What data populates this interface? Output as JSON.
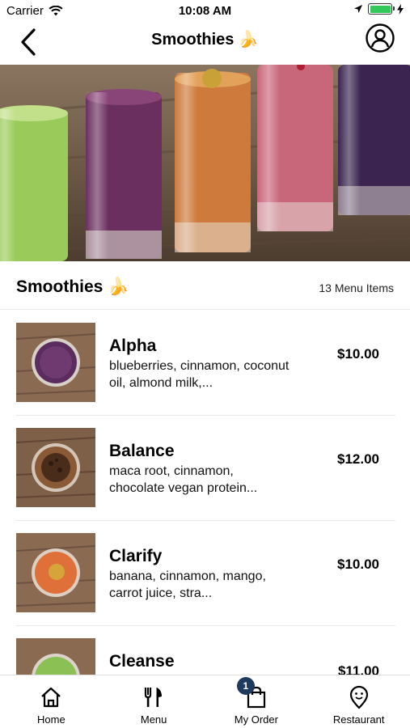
{
  "status_bar": {
    "carrier": "Carrier",
    "time": "10:08 AM",
    "battery_color": "#34c759"
  },
  "nav": {
    "title": "Smoothies 🍌",
    "back_icon": "chevron-left-icon",
    "profile_icon": "user-circle-icon"
  },
  "section": {
    "title": "Smoothies 🍌",
    "count": "13 Menu Items"
  },
  "menu_items": [
    {
      "name": "Alpha",
      "desc": " blueberries, cinnamon, coconut oil, almond milk,...",
      "price": "$10.00",
      "color": "#5b2d5e"
    },
    {
      "name": "Balance",
      "desc": " maca root, cinnamon, chocolate vegan protein...",
      "price": "$12.00",
      "color": "#6b3d22"
    },
    {
      "name": "Clarify",
      "desc": " banana, cinnamon, mango, carrot juice, stra...",
      "price": "$10.00",
      "color": "#e0703a"
    },
    {
      "name": "Cleanse",
      "desc": "",
      "price": "$11.00",
      "color": "#8ac054"
    }
  ],
  "tabs": [
    {
      "label": "Home",
      "icon": "home-icon"
    },
    {
      "label": "Menu",
      "icon": "fork-knife-icon"
    },
    {
      "label": "My Order",
      "icon": "shopping-bag-icon",
      "badge": "1"
    },
    {
      "label": "Restaurant",
      "icon": "location-pin-icon"
    }
  ],
  "colors": {
    "badge": "#1e3a5f",
    "divider": "#e6e6e6"
  }
}
